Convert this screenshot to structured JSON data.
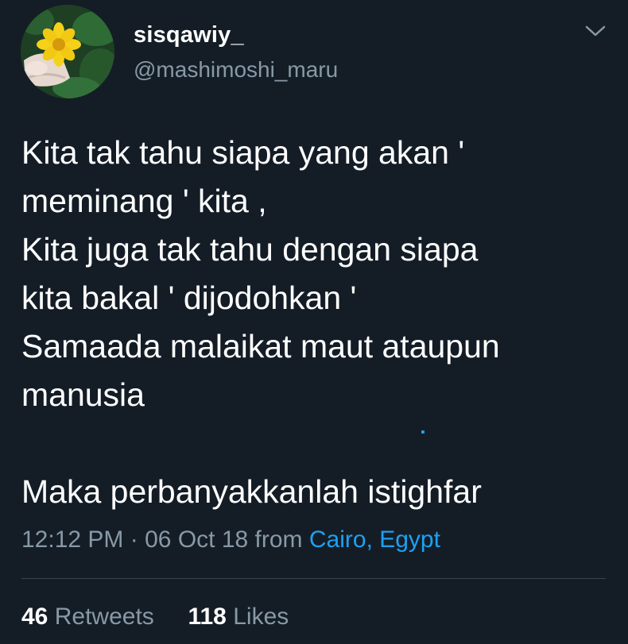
{
  "header": {
    "display_name": "sisqawiy_",
    "handle": "@mashimoshi_maru",
    "menu_icon": "chevron-down-icon",
    "avatar_icon": "avatar-flower-icon"
  },
  "tweet": {
    "lines": [
      "Kita tak tahu siapa yang akan '",
      "meminang ' kita ,",
      "Kita juga tak tahu dengan siapa",
      "kita bakal ' dijodohkan '",
      "Samaada malaikat maut ataupun",
      "manusia",
      "",
      "Maka perbanyakkanlah istighfar"
    ]
  },
  "meta": {
    "time": "12:12 PM",
    "separator": "·",
    "date": "06 Oct 18",
    "from_label": "from",
    "location": "Cairo, Egypt"
  },
  "stats": {
    "retweets_count": "46",
    "retweets_label": "Retweets",
    "likes_count": "118",
    "likes_label": "Likes"
  },
  "colors": {
    "background": "#141d26",
    "text_primary": "#ffffff",
    "text_secondary": "#8899a6",
    "link": "#1da1f2",
    "divider": "#38444d"
  }
}
